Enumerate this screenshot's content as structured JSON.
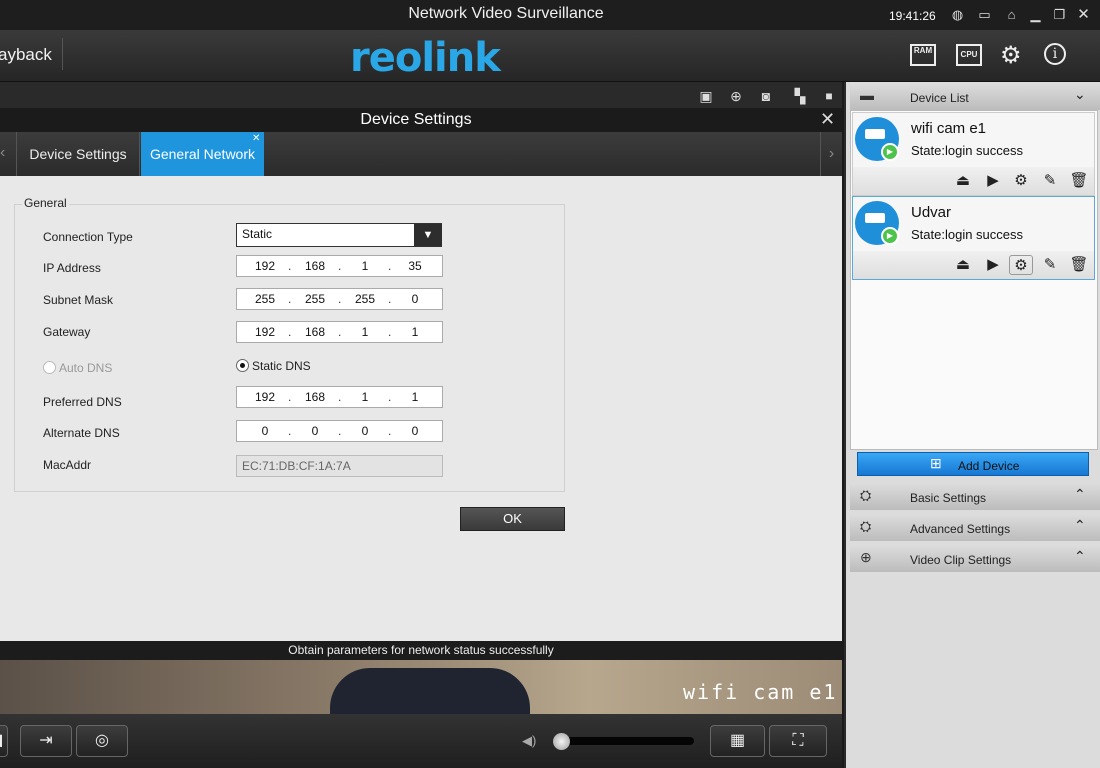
{
  "window": {
    "title": "Network Video Surveillance",
    "clock": "19:41:26"
  },
  "toolbar": {
    "playback_label": "ayback",
    "logo": "reolink",
    "ram": "RAM",
    "cpu": "CPU"
  },
  "dialog": {
    "title": "Device Settings",
    "tabs": [
      {
        "label": "Device Settings"
      },
      {
        "label": "General Network"
      }
    ],
    "group_label": "General",
    "connection_type": {
      "label": "Connection Type",
      "value": "Static"
    },
    "ip_address": {
      "label": "IP Address",
      "octets": [
        "192",
        "168",
        "1",
        "35"
      ]
    },
    "subnet_mask": {
      "label": "Subnet Mask",
      "octets": [
        "255",
        "255",
        "255",
        "0"
      ]
    },
    "gateway": {
      "label": "Gateway",
      "octets": [
        "192",
        "168",
        "1",
        "1"
      ]
    },
    "auto_dns": {
      "label": "Auto DNS",
      "checked": false
    },
    "static_dns": {
      "label": "Static DNS",
      "checked": true
    },
    "preferred_dns": {
      "label": "Preferred DNS",
      "octets": [
        "192",
        "168",
        "1",
        "1"
      ]
    },
    "alternate_dns": {
      "label": "Alternate DNS",
      "octets": [
        "0",
        "0",
        "0",
        "0"
      ]
    },
    "mac": {
      "label": "MacAddr",
      "value": "EC:71:DB:CF:1A:7A"
    },
    "ok_label": "OK"
  },
  "status": {
    "message": "Obtain parameters for network status successfully"
  },
  "video": {
    "caption": "wifi cam e1"
  },
  "right_panel": {
    "device_list_label": "Device List",
    "devices": [
      {
        "name": "wifi cam e1",
        "state": "State:login success"
      },
      {
        "name": "Udvar",
        "state": "State:login success"
      }
    ],
    "add_device_label": "Add Device",
    "sections": [
      {
        "label": "Basic Settings"
      },
      {
        "label": "Advanced Settings"
      },
      {
        "label": "Video Clip Settings"
      }
    ]
  },
  "colors": {
    "accent": "#1e95dc",
    "logo": "#2aa7e6",
    "play_green": "#4cc34a"
  }
}
